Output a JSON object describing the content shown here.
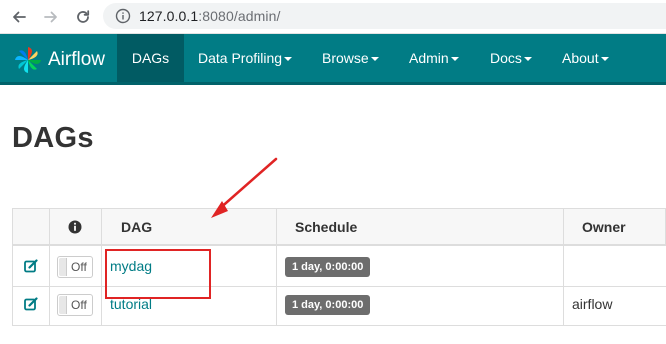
{
  "browser": {
    "url_host": "127.0.0.1",
    "url_rest": ":8080/admin/"
  },
  "navbar": {
    "brand": "Airflow",
    "items": [
      {
        "label": "DAGs",
        "active": true
      },
      {
        "label": "Data Profiling",
        "dropdown": true
      },
      {
        "label": "Browse",
        "dropdown": true
      },
      {
        "label": "Admin",
        "dropdown": true
      },
      {
        "label": "Docs",
        "dropdown": true
      },
      {
        "label": "About",
        "dropdown": true
      }
    ]
  },
  "page": {
    "title": "DAGs"
  },
  "table": {
    "headers": {
      "dag": "DAG",
      "schedule": "Schedule",
      "owner": "Owner"
    },
    "rows": [
      {
        "toggle": "Off",
        "dag": "mydag",
        "schedule": "1 day, 0:00:00",
        "owner": ""
      },
      {
        "toggle": "Off",
        "dag": "tutorial",
        "schedule": "1 day, 0:00:00",
        "owner": "airflow"
      }
    ]
  },
  "colors": {
    "navbar": "#017c85",
    "navbar_active": "#015b63",
    "link": "#017c85",
    "annotation": "#e02424"
  }
}
